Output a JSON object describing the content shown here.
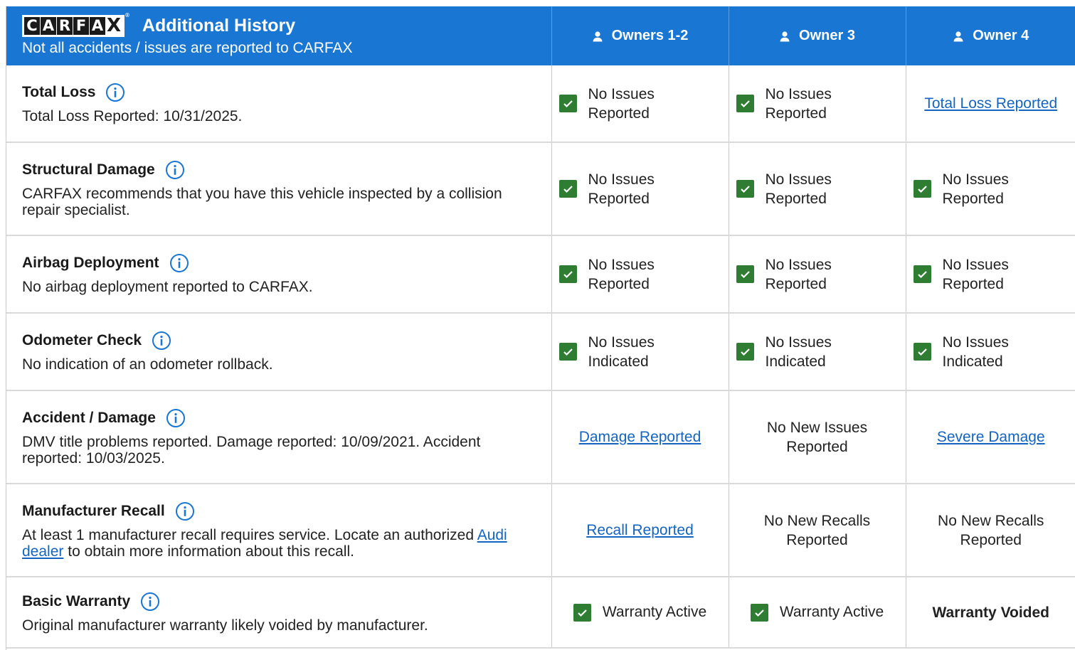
{
  "header": {
    "logo_letters": [
      "C",
      "A",
      "R",
      "F",
      "A",
      "X"
    ],
    "logo_reg": "®",
    "title": "Additional History",
    "subtitle": "Not all accidents / issues are reported to CARFAX",
    "owners": [
      "Owners 1-2",
      "Owner 3",
      "Owner 4"
    ]
  },
  "rows": [
    {
      "label": "Total Loss",
      "description": "Total Loss Reported: 10/31/2025.",
      "cells": [
        {
          "type": "check",
          "text": "No Issues Reported"
        },
        {
          "type": "check",
          "text": "No Issues Reported"
        },
        {
          "type": "link",
          "text": "Total Loss Reported"
        }
      ]
    },
    {
      "label": "Structural Damage",
      "description": "CARFAX recommends that you have this vehicle inspected by a collision repair specialist.",
      "cells": [
        {
          "type": "check",
          "text": "No Issues Reported"
        },
        {
          "type": "check",
          "text": "No Issues Reported"
        },
        {
          "type": "check",
          "text": "No Issues Reported"
        }
      ]
    },
    {
      "label": "Airbag Deployment",
      "description": "No airbag deployment reported to CARFAX.",
      "cells": [
        {
          "type": "check",
          "text": "No Issues Reported"
        },
        {
          "type": "check",
          "text": "No Issues Reported"
        },
        {
          "type": "check",
          "text": "No Issues Reported"
        }
      ]
    },
    {
      "label": "Odometer Check",
      "description": "No indication of an odometer rollback.",
      "cells": [
        {
          "type": "check",
          "text": "No Issues Indicated"
        },
        {
          "type": "check",
          "text": "No Issues Indicated"
        },
        {
          "type": "check",
          "text": "No Issues Indicated"
        }
      ]
    },
    {
      "label": "Accident / Damage",
      "description": "DMV title problems reported. Damage reported: 10/09/2021. Accident reported: 10/03/2025.",
      "cells": [
        {
          "type": "link",
          "text": "Damage Reported"
        },
        {
          "type": "text",
          "text": "No New Issues Reported"
        },
        {
          "type": "link",
          "text": "Severe Damage"
        }
      ]
    },
    {
      "label": "Manufacturer Recall",
      "description_before": "At least 1 manufacturer recall requires service. Locate an authorized",
      "description_link": "Audi dealer",
      "description_after": "to obtain more information about this recall.",
      "cells": [
        {
          "type": "link",
          "text": "Recall Reported"
        },
        {
          "type": "text",
          "text": "No New Recalls Reported"
        },
        {
          "type": "text",
          "text": "No New Recalls Reported"
        }
      ]
    },
    {
      "label": "Basic Warranty",
      "description": "Original manufacturer warranty likely voided by manufacturer.",
      "cells": [
        {
          "type": "warranty",
          "text": "Warranty Active"
        },
        {
          "type": "warranty",
          "text": "Warranty Active"
        },
        {
          "type": "bold",
          "text": "Warranty Voided"
        }
      ]
    }
  ],
  "colors": {
    "header_bg": "#1976d2",
    "check_green": "#2e7d32",
    "link_blue": "#1565c0"
  },
  "icons": {
    "info": "info-circle-icon",
    "check": "checkbox-checked-icon",
    "owner": "person-icon"
  }
}
